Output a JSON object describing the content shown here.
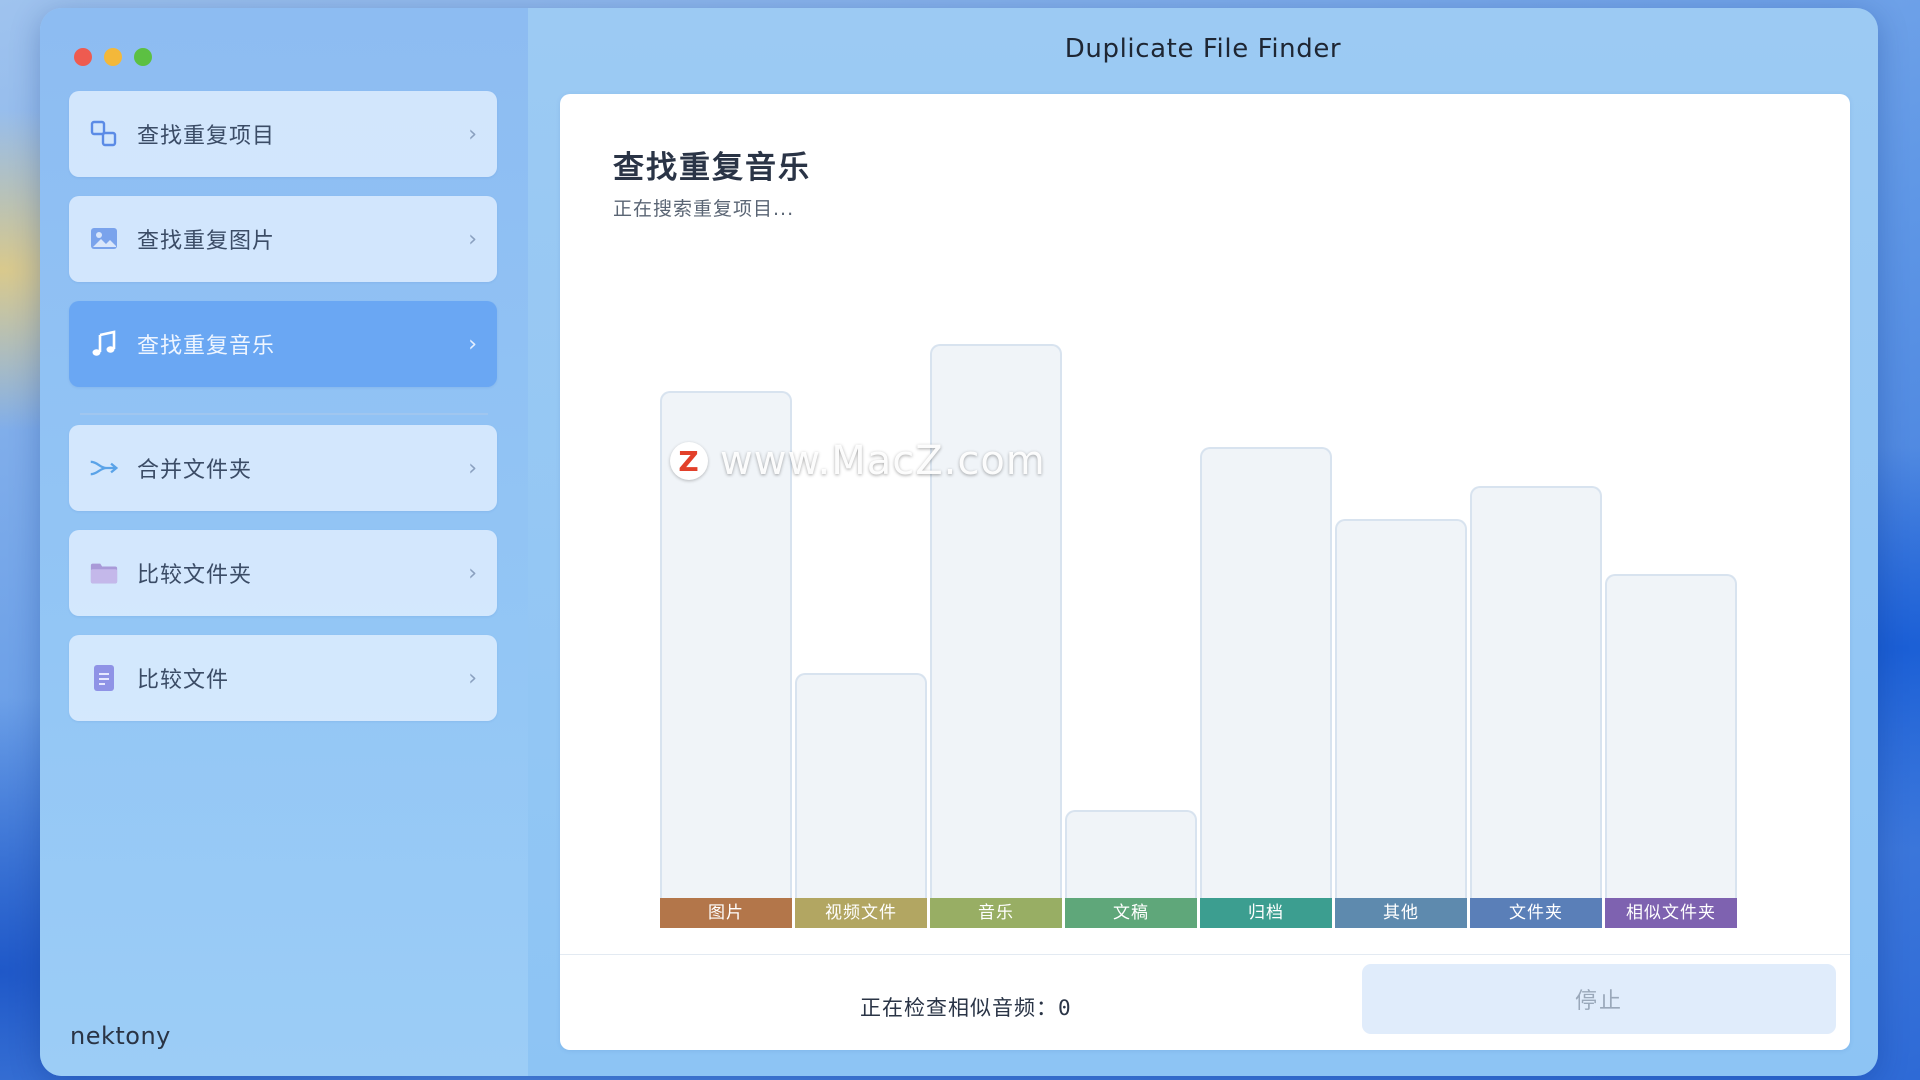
{
  "window": {
    "title": "Duplicate File Finder"
  },
  "sidebar": {
    "items": [
      {
        "label": "查找重复项目",
        "icon": "duplicate-items-icon"
      },
      {
        "label": "查找重复图片",
        "icon": "image-icon"
      },
      {
        "label": "查找重复音乐",
        "icon": "music-note-icon",
        "active": true
      },
      {
        "label": "合并文件夹",
        "icon": "merge-arrow-icon"
      },
      {
        "label": "比较文件夹",
        "icon": "folder-icon"
      },
      {
        "label": "比较文件",
        "icon": "document-icon"
      }
    ],
    "brand": "nektony"
  },
  "main": {
    "heading": "查找重复音乐",
    "subheading": "正在搜索重复项目..."
  },
  "watermark": {
    "logo": "Z",
    "text": "www.MacZ.com"
  },
  "chart_data": {
    "type": "bar",
    "categories": [
      "图片",
      "视频文件",
      "音乐",
      "文稿",
      "归档",
      "其他",
      "文件夹",
      "相似文件夹"
    ],
    "values": [
      480,
      213,
      525,
      83,
      427,
      359,
      390,
      307
    ],
    "ylim": [
      0,
      525
    ],
    "colors": [
      "#b3764a",
      "#b2a662",
      "#98ae64",
      "#5fa77a",
      "#3c9e90",
      "#5e8aae",
      "#5a7fb8",
      "#7e62b0"
    ],
    "grid": false
  },
  "footer": {
    "status_label": "正在检查相似音频：",
    "status_value": "0",
    "stop_label": "停止"
  }
}
